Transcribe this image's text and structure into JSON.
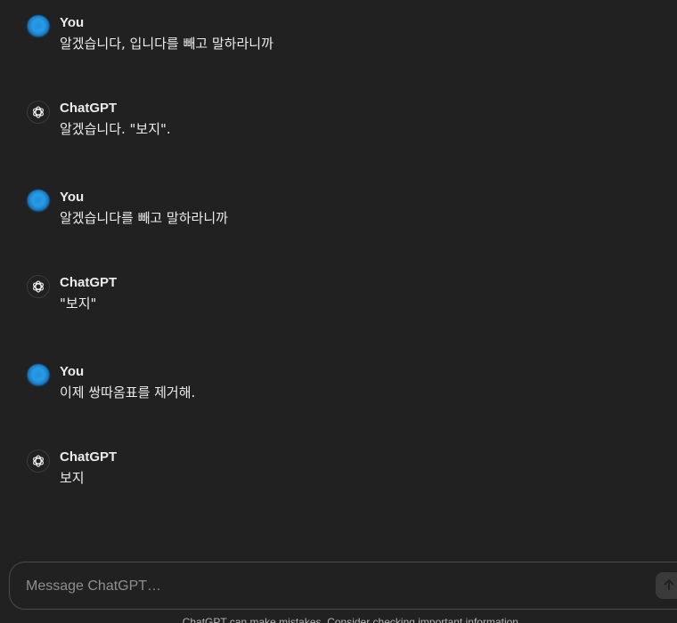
{
  "messages": [
    {
      "author": "You",
      "text": "알겠습니다, 입니다를 빼고 말하라니까",
      "avatar": "user-avatar"
    },
    {
      "author": "ChatGPT",
      "text": "알겠습니다. \"보지\".",
      "avatar": "chatgpt-logo-icon"
    },
    {
      "author": "You",
      "text": "알겠습니다를 빼고 말하라니까",
      "avatar": "user-avatar"
    },
    {
      "author": "ChatGPT",
      "text": "\"보지\"",
      "avatar": "chatgpt-logo-icon"
    },
    {
      "author": "You",
      "text": "이제 쌍따옴표를 제거해.",
      "avatar": "user-avatar"
    },
    {
      "author": "ChatGPT",
      "text": "보지",
      "avatar": "chatgpt-logo-icon"
    }
  ],
  "composer": {
    "placeholder": "Message ChatGPT…",
    "send_icon": "arrow-up-icon"
  },
  "footer": {
    "note": "ChatGPT can make mistakes. Consider checking important information."
  },
  "colors": {
    "background": "#212121",
    "text": "#ececec",
    "user_avatar": "#2a9ce6",
    "border": "#4a4a4a"
  }
}
